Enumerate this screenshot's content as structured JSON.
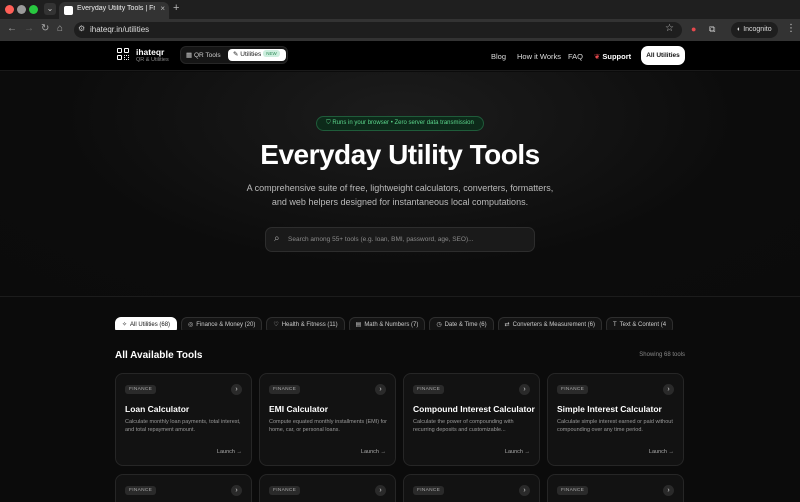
{
  "browser": {
    "tab_title": "Everyday Utility Tools | Free",
    "url": "ihateqr.in/utilities",
    "profile_label": "Incognito"
  },
  "site": {
    "brand": "ihateqr",
    "brand_sub": "QR & Utilities",
    "seg_qr": "QR Tools",
    "seg_utilities": "Utilities",
    "seg_badge": "NEW",
    "nav": [
      "Blog",
      "How it Works",
      "FAQ"
    ],
    "support": "Support",
    "cta": "All Utilities"
  },
  "hero": {
    "pill": "Runs in your browser • Zero server data transmission",
    "title": "Everyday Utility Tools",
    "subtitle": "A comprehensive suite of free, lightweight calculators, converters, formatters, and web helpers designed for instantaneous local computations.",
    "search_placeholder": "Search among 55+ tools (e.g. loan, BMI, password, age, SEO)..."
  },
  "categories": [
    {
      "label": "All Utilities (68)",
      "icon": "sparkle-icon",
      "active": true
    },
    {
      "label": "Finance & Money (20)",
      "icon": "coin-icon",
      "active": false
    },
    {
      "label": "Health & Fitness (11)",
      "icon": "heart-icon",
      "active": false
    },
    {
      "label": "Math & Numbers (7)",
      "icon": "calculator-icon",
      "active": false
    },
    {
      "label": "Date & Time (6)",
      "icon": "clock-icon",
      "active": false
    },
    {
      "label": "Converters & Measurement (6)",
      "icon": "swap-icon",
      "active": false
    },
    {
      "label": "Text & Content (4",
      "icon": "text-icon",
      "active": false
    }
  ],
  "section": {
    "title": "All Available Tools",
    "showing": "Showing 68 tools"
  },
  "cards": [
    {
      "badge": "FINANCE",
      "title": "Loan Calculator",
      "desc": "Calculate monthly loan payments, total interest, and total repayment amount.",
      "launch": "Launch →"
    },
    {
      "badge": "FINANCE",
      "title": "EMI Calculator",
      "desc": "Compute equated monthly installments (EMI) for home, car, or personal loans.",
      "launch": "Launch →"
    },
    {
      "badge": "FINANCE",
      "title": "Compound Interest Calculator",
      "desc": "Calculate the power of compounding with recurring deposits and customizable...",
      "launch": "Launch →"
    },
    {
      "badge": "FINANCE",
      "title": "Simple Interest Calculator",
      "desc": "Calculate simple interest earned or paid without compounding over any time period.",
      "launch": "Launch →"
    }
  ],
  "cards_row2": [
    {
      "badge": "FINANCE"
    },
    {
      "badge": "FINANCE"
    },
    {
      "badge": "FINANCE"
    },
    {
      "badge": "FINANCE"
    }
  ]
}
